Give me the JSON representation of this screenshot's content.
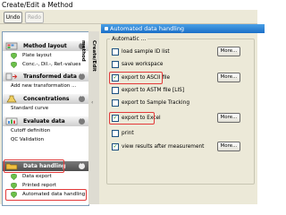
{
  "window": {
    "title": "Create/Edit a Method"
  },
  "toolbar": {
    "undo": "Undo",
    "redo": "Redo"
  },
  "nav": {
    "vertical_tab": "Create/Edit method",
    "sections": [
      {
        "header": "Method layout",
        "items": [
          "Plate layout",
          "Conc.-, Dil.-, Ref.-values"
        ]
      },
      {
        "header": "Transformed data",
        "items": [
          "Add new transformation ..."
        ]
      },
      {
        "header": "Concentrations",
        "items": [
          "Standard curve"
        ]
      },
      {
        "header": "Evaluate data",
        "items": [
          "Cutoff definition",
          "QC Validation"
        ]
      },
      {
        "header": "Data handling",
        "items": [
          "Data export",
          "Printed report",
          "Automated data handling"
        ]
      }
    ]
  },
  "panel": {
    "title": "Automated data handling",
    "group_label": "Automatic ...",
    "options": [
      {
        "label": "load sample ID list",
        "checked": false
      },
      {
        "label": "save workspace",
        "checked": false
      },
      {
        "label": "export to ASCII file",
        "checked": true
      },
      {
        "label": "export to ASTM file [LIS]",
        "checked": false
      },
      {
        "label": "export to Sample Tracking",
        "checked": false
      },
      {
        "label": "export to Excel",
        "checked": true
      },
      {
        "label": "print",
        "checked": false
      },
      {
        "label": "view results after measurement",
        "checked": true
      }
    ],
    "more_label": "More...",
    "checkmark": "✓"
  },
  "colors": {
    "highlight": "#e33a3a",
    "title_bar": "#1b6fc7",
    "active_section": "#4e4e4e",
    "check_green": "#1c8a1c"
  },
  "icons": {
    "collapse": "chevron-up-icon",
    "tab_arrow": "chevron-left-icon"
  }
}
